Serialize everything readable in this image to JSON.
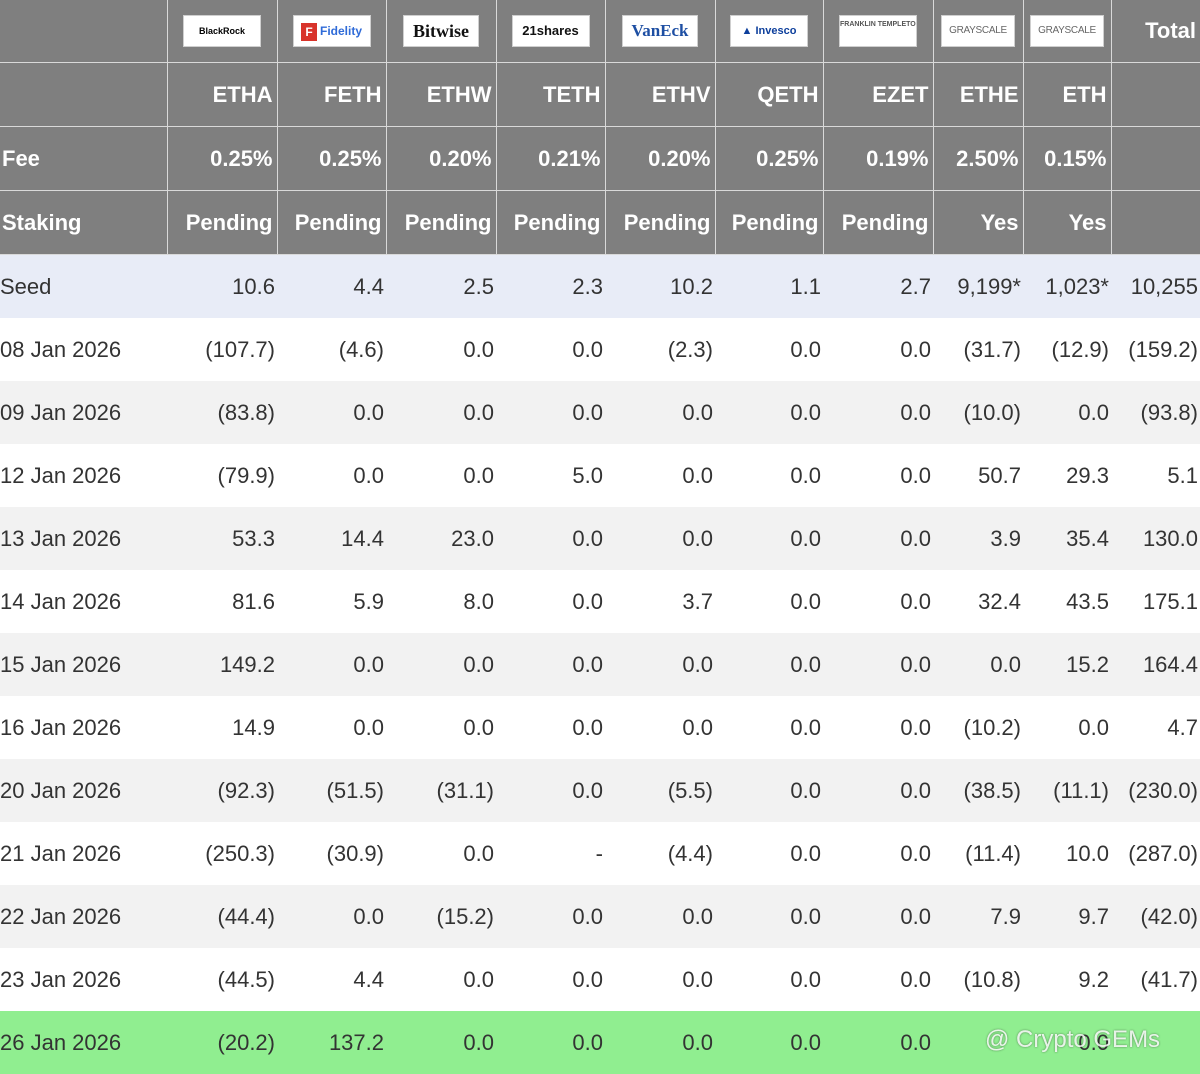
{
  "issuers": [
    "BlackRock",
    "Fidelity",
    "Bitwise",
    "21shares",
    "VanEck",
    "Invesco",
    "FRANKLIN TEMPLETON",
    "GRAYSCALE",
    "GRAYSCALE"
  ],
  "total_label": "Total",
  "tickers": [
    "ETHA",
    "FETH",
    "ETHW",
    "TETH",
    "ETHV",
    "QETH",
    "EZET",
    "ETHE",
    "ETH"
  ],
  "fee_label": "Fee",
  "fees": [
    "0.25%",
    "0.25%",
    "0.20%",
    "0.21%",
    "0.20%",
    "0.25%",
    "0.19%",
    "2.50%",
    "0.15%"
  ],
  "staking_label": "Staking",
  "staking": [
    "Pending",
    "Pending",
    "Pending",
    "Pending",
    "Pending",
    "Pending",
    "Pending",
    "Yes",
    "Yes"
  ],
  "rows": [
    {
      "label": "Seed",
      "values": [
        "10.6",
        "4.4",
        "2.5",
        "2.3",
        "10.2",
        "1.1",
        "2.7",
        "9,199*",
        "1,023*",
        "10,255"
      ]
    },
    {
      "label": "08 Jan 2026",
      "values": [
        "(107.7)",
        "(4.6)",
        "0.0",
        "0.0",
        "(2.3)",
        "0.0",
        "0.0",
        "(31.7)",
        "(12.9)",
        "(159.2)"
      ]
    },
    {
      "label": "09 Jan 2026",
      "values": [
        "(83.8)",
        "0.0",
        "0.0",
        "0.0",
        "0.0",
        "0.0",
        "0.0",
        "(10.0)",
        "0.0",
        "(93.8)"
      ]
    },
    {
      "label": "12 Jan 2026",
      "values": [
        "(79.9)",
        "0.0",
        "0.0",
        "5.0",
        "0.0",
        "0.0",
        "0.0",
        "50.7",
        "29.3",
        "5.1"
      ]
    },
    {
      "label": "13 Jan 2026",
      "values": [
        "53.3",
        "14.4",
        "23.0",
        "0.0",
        "0.0",
        "0.0",
        "0.0",
        "3.9",
        "35.4",
        "130.0"
      ]
    },
    {
      "label": "14 Jan 2026",
      "values": [
        "81.6",
        "5.9",
        "8.0",
        "0.0",
        "3.7",
        "0.0",
        "0.0",
        "32.4",
        "43.5",
        "175.1"
      ]
    },
    {
      "label": "15 Jan 2026",
      "values": [
        "149.2",
        "0.0",
        "0.0",
        "0.0",
        "0.0",
        "0.0",
        "0.0",
        "0.0",
        "15.2",
        "164.4"
      ]
    },
    {
      "label": "16 Jan 2026",
      "values": [
        "14.9",
        "0.0",
        "0.0",
        "0.0",
        "0.0",
        "0.0",
        "0.0",
        "(10.2)",
        "0.0",
        "4.7"
      ]
    },
    {
      "label": "20 Jan 2026",
      "values": [
        "(92.3)",
        "(51.5)",
        "(31.1)",
        "0.0",
        "(5.5)",
        "0.0",
        "0.0",
        "(38.5)",
        "(11.1)",
        "(230.0)"
      ]
    },
    {
      "label": "21 Jan 2026",
      "values": [
        "(250.3)",
        "(30.9)",
        "0.0",
        "-",
        "(4.4)",
        "0.0",
        "0.0",
        "(11.4)",
        "10.0",
        "(287.0)"
      ]
    },
    {
      "label": "22 Jan 2026",
      "values": [
        "(44.4)",
        "0.0",
        "(15.2)",
        "0.0",
        "0.0",
        "0.0",
        "0.0",
        "7.9",
        "9.7",
        "(42.0)"
      ]
    },
    {
      "label": "23 Jan 2026",
      "values": [
        "(44.5)",
        "4.4",
        "0.0",
        "0.0",
        "0.0",
        "0.0",
        "0.0",
        "(10.8)",
        "9.2",
        "(41.7)"
      ]
    },
    {
      "label": "26 Jan 2026",
      "values": [
        "(20.2)",
        "137.2",
        "0.0",
        "0.0",
        "0.0",
        "0.0",
        "0.0",
        "",
        "0.0",
        ""
      ]
    }
  ],
  "watermark": "@ Crypto GEMs",
  "colors": {
    "header_bg": "#7f7f7f",
    "seed_bg": "#e8ecf7",
    "zebra_bg": "#f2f2f2",
    "highlight_bg": "#90ee90",
    "negative": "#d0323a"
  }
}
